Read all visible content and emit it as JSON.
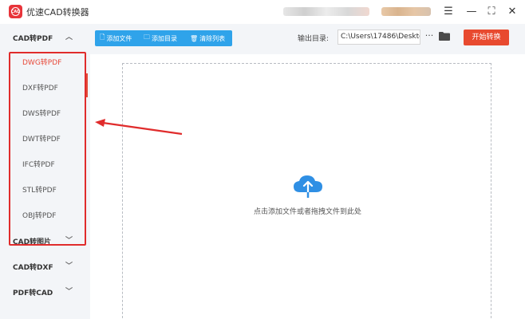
{
  "app": {
    "title": "优速CAD转换器",
    "logo_text": "CAD"
  },
  "window": {
    "menu_icon": "menu-icon",
    "min_icon": "minimize-icon",
    "max_icon": "maximize-icon",
    "close_icon": "close-icon"
  },
  "sidebar": {
    "categories": [
      {
        "label": "CAD转PDF",
        "expanded": true
      },
      {
        "label": "CAD转图片",
        "expanded": false
      },
      {
        "label": "CAD转DXF",
        "expanded": false
      },
      {
        "label": "PDF转CAD",
        "expanded": false
      }
    ],
    "sub_items": [
      {
        "label": "DWG转PDF",
        "active": true
      },
      {
        "label": "DXF转PDF",
        "active": false
      },
      {
        "label": "DWS转PDF",
        "active": false
      },
      {
        "label": "DWT转PDF",
        "active": false
      },
      {
        "label": "IFC转PDF",
        "active": false
      },
      {
        "label": "STL转PDF",
        "active": false
      },
      {
        "label": "OBJ转PDF",
        "active": false
      }
    ]
  },
  "toolbar": {
    "add_file": "添加文件",
    "add_dir": "添加目录",
    "clear_list": "清除列表",
    "output_label": "输出目录:",
    "output_path": "C:\\Users\\17486\\Deskto",
    "more": "···",
    "start": "开始转换"
  },
  "dropzone": {
    "hint": "点击添加文件或者拖拽文件到此处"
  },
  "colors": {
    "accent_blue": "#2fa3ea",
    "accent_red": "#e84a2f",
    "highlight_red": "#e02c2c",
    "sidebar_bg": "#f3f5f8"
  }
}
